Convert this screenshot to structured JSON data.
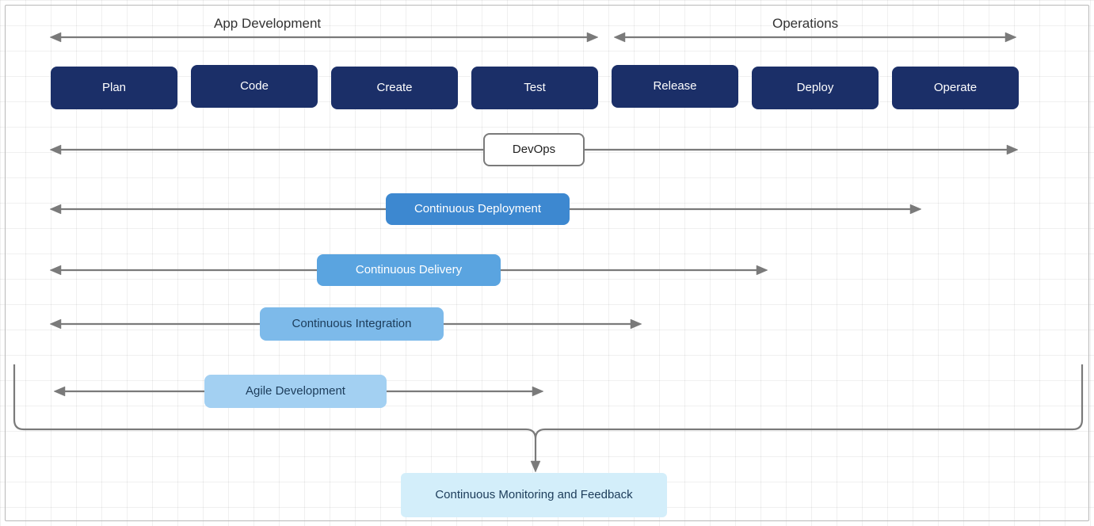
{
  "sections": {
    "app_dev": "App Development",
    "ops": "Operations"
  },
  "stages": {
    "plan": "Plan",
    "code": "Code",
    "create": "Create",
    "test": "Test",
    "release": "Release",
    "deploy": "Deploy",
    "operate": "Operate"
  },
  "spans": {
    "devops": "DevOps",
    "cd": "Continuous Deployment",
    "cdel": "Continuous Delivery",
    "ci": "Continuous Integration",
    "agile": "Agile Development"
  },
  "monitoring": "Continuous Monitoring and Feedback",
  "chart_data": {
    "type": "table",
    "title": "DevOps lifecycle spans and coverage",
    "stages": [
      "Plan",
      "Code",
      "Create",
      "Test",
      "Release",
      "Deploy",
      "Operate"
    ],
    "sections": {
      "App Development": [
        "Plan",
        "Code",
        "Create",
        "Test"
      ],
      "Operations": [
        "Release",
        "Deploy",
        "Operate"
      ]
    },
    "spans": [
      {
        "name": "DevOps",
        "covers": [
          "Plan",
          "Code",
          "Create",
          "Test",
          "Release",
          "Deploy",
          "Operate"
        ]
      },
      {
        "name": "Continuous Deployment",
        "covers": [
          "Plan",
          "Code",
          "Create",
          "Test",
          "Release",
          "Deploy"
        ]
      },
      {
        "name": "Continuous Delivery",
        "covers": [
          "Plan",
          "Code",
          "Create",
          "Test",
          "Release"
        ]
      },
      {
        "name": "Continuous Integration",
        "covers": [
          "Plan",
          "Code",
          "Create",
          "Test"
        ]
      },
      {
        "name": "Agile Development",
        "covers": [
          "Plan",
          "Code",
          "Create"
        ]
      }
    ],
    "all_feed_into": "Continuous Monitoring and Feedback"
  }
}
